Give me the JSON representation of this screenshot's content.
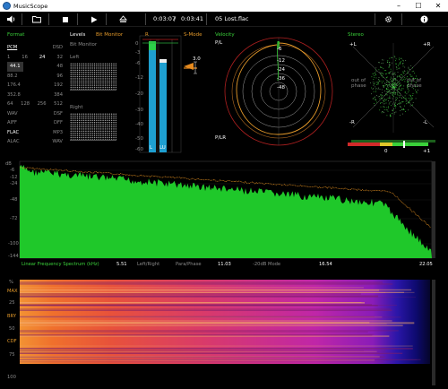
{
  "window": {
    "title": "MusicScope"
  },
  "toolbar": {
    "position": "0:03:07",
    "separator": "/",
    "duration": "0:03:41",
    "track": "05 Lost.flac"
  },
  "format": {
    "title": "Format",
    "header": [
      "PCM",
      "DSD"
    ],
    "rows": [
      [
        "1",
        "16",
        "24",
        "32"
      ],
      [
        "44.1",
        "48"
      ],
      [
        "88.2",
        "96"
      ],
      [
        "176.4",
        "192"
      ],
      [
        "352.8",
        "384"
      ],
      [
        "64",
        "128",
        "256",
        "512"
      ],
      [
        "WAV",
        "DSF"
      ],
      [
        "AIFF",
        "DFF"
      ],
      [
        "FLAC",
        "MP3"
      ],
      [
        "ALAC",
        "WAV"
      ]
    ]
  },
  "levels": {
    "title": "Levels",
    "mode": "Bit Monitor",
    "sub_mode": "Bit Monitor",
    "left": "Left",
    "right": "Right"
  },
  "meter": {
    "scale": [
      "0",
      "-3",
      "-6",
      "-12",
      "-20",
      "-30",
      "-40",
      "-50",
      "-60"
    ],
    "indicator_r": "R",
    "indicator_s": "S-Mode",
    "lr_labels": [
      "L",
      "LU"
    ],
    "peak_value": "3.0",
    "levels_fraction": [
      0.93,
      0.82
    ]
  },
  "velocity": {
    "title": "Velocity",
    "top_label": "P/L",
    "bottom_label": "P/LR",
    "rings": [
      "-6",
      "-12",
      "-24",
      "-36",
      "-48"
    ]
  },
  "stereo": {
    "title": "Stereo",
    "plus_l": "+L",
    "plus_r": "+R",
    "minus_r": "-R",
    "minus_l": "-L",
    "out_of_phase_left": "out of phase",
    "out_of_phase_right": "out of phase",
    "corr_scale": [
      "0",
      "+1"
    ]
  },
  "spectrum": {
    "db_label": "dB",
    "y_ticks": [
      "-6",
      "-12",
      "-24",
      "-48",
      "-72",
      "-100",
      "-144"
    ],
    "footer": {
      "mode": "Linear Frequency Spectrum (kHz)",
      "f1": "5.51",
      "lr": "Left/Right",
      "f2": "11.03",
      "peak": "Para/Phase",
      "zoom": "-20dB Mode",
      "f3": "16.54",
      "f4": "22.05"
    }
  },
  "spectrogram": {
    "y_ticks": [
      "%",
      "MAX",
      "25",
      "BRY",
      "50",
      "CDF",
      "75",
      "100"
    ]
  },
  "colors": {
    "accent_green": "#3ad13a",
    "accent_orange": "#e59a2a",
    "meter_blue": "#1a8ab8",
    "spectrum_fill": "#1fc82a"
  }
}
